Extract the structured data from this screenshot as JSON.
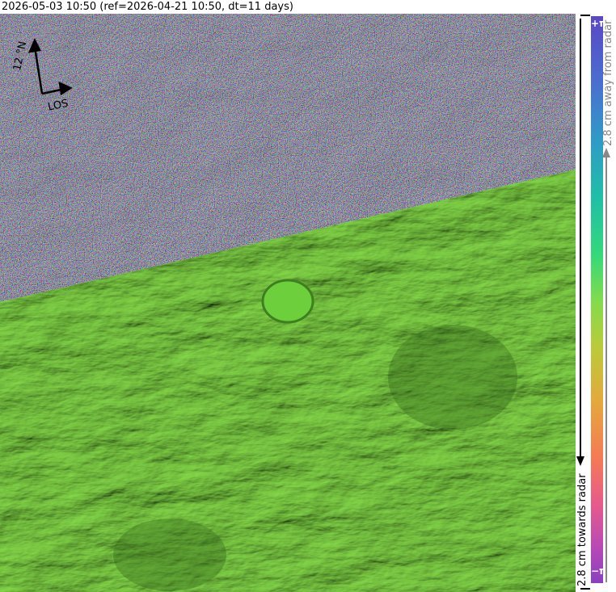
{
  "title": "2026-05-03 10:50 (ref=2026-04-21 10:50, dt=11 days)",
  "compass": {
    "north_label": "12 °N",
    "los_label": "LOS"
  },
  "colorbar": {
    "top_label": "+π",
    "bottom_label": "−π",
    "away_label": "2.8 cm away from radar",
    "towards_label": "2.8 cm towards radar"
  },
  "colors": {
    "terrain_green": "#74d63f",
    "noise_accent": "#b07ab0"
  }
}
